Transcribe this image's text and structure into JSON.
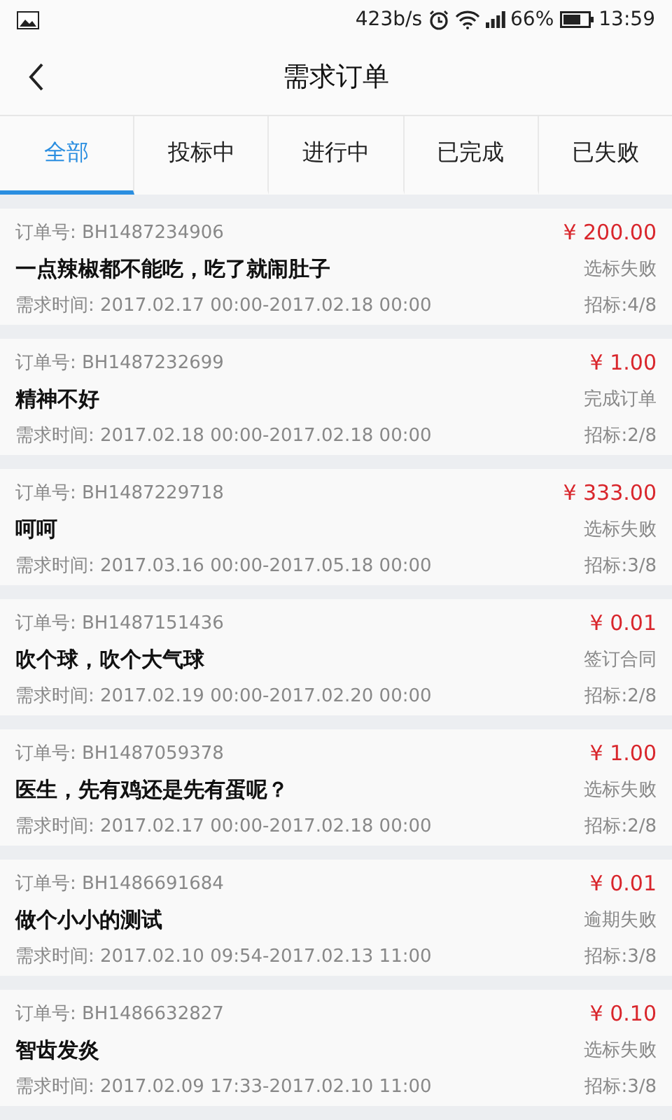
{
  "status_bar": {
    "speed": "423b/s",
    "battery": "66%",
    "time": "13:59"
  },
  "header": {
    "title": "需求订单"
  },
  "tabs": [
    {
      "label": "全部",
      "selected": true
    },
    {
      "label": "投标中",
      "selected": false
    },
    {
      "label": "进行中",
      "selected": false
    },
    {
      "label": "已完成",
      "selected": false
    },
    {
      "label": "已失败",
      "selected": false
    }
  ],
  "orders": [
    {
      "number": "订单号: BH1487234906",
      "price": "¥ 200.00",
      "title": "一点辣椒都不能吃，吃了就闹肚子",
      "status": "选标失败",
      "time": "需求时间: 2017.02.17 00:00-2017.02.18 00:00",
      "bids": "招标:4/8"
    },
    {
      "number": "订单号: BH1487232699",
      "price": "¥ 1.00",
      "title": "精神不好",
      "status": "完成订单",
      "time": "需求时间: 2017.02.18 00:00-2017.02.18 00:00",
      "bids": "招标:2/8"
    },
    {
      "number": "订单号: BH1487229718",
      "price": "¥ 333.00",
      "title": "呵呵",
      "status": "选标失败",
      "time": "需求时间: 2017.03.16 00:00-2017.05.18 00:00",
      "bids": "招标:3/8"
    },
    {
      "number": "订单号: BH1487151436",
      "price": "¥ 0.01",
      "title": "吹个球，吹个大气球",
      "status": "签订合同",
      "time": "需求时间: 2017.02.19 00:00-2017.02.20 00:00",
      "bids": "招标:2/8"
    },
    {
      "number": "订单号: BH1487059378",
      "price": "¥ 1.00",
      "title": "医生，先有鸡还是先有蛋呢？",
      "status": "选标失败",
      "time": "需求时间: 2017.02.17 00:00-2017.02.18 00:00",
      "bids": "招标:2/8"
    },
    {
      "number": "订单号: BH1486691684",
      "price": "¥ 0.01",
      "title": "做个小小的测试",
      "status": "逾期失败",
      "time": "需求时间: 2017.02.10 09:54-2017.02.13 11:00",
      "bids": "招标:3/8"
    },
    {
      "number": "订单号: BH1486632827",
      "price": "¥ 0.10",
      "title": "智齿发炎",
      "status": "选标失败",
      "time": "需求时间: 2017.02.09 17:33-2017.02.10 11:00",
      "bids": "招标:3/8"
    }
  ]
}
